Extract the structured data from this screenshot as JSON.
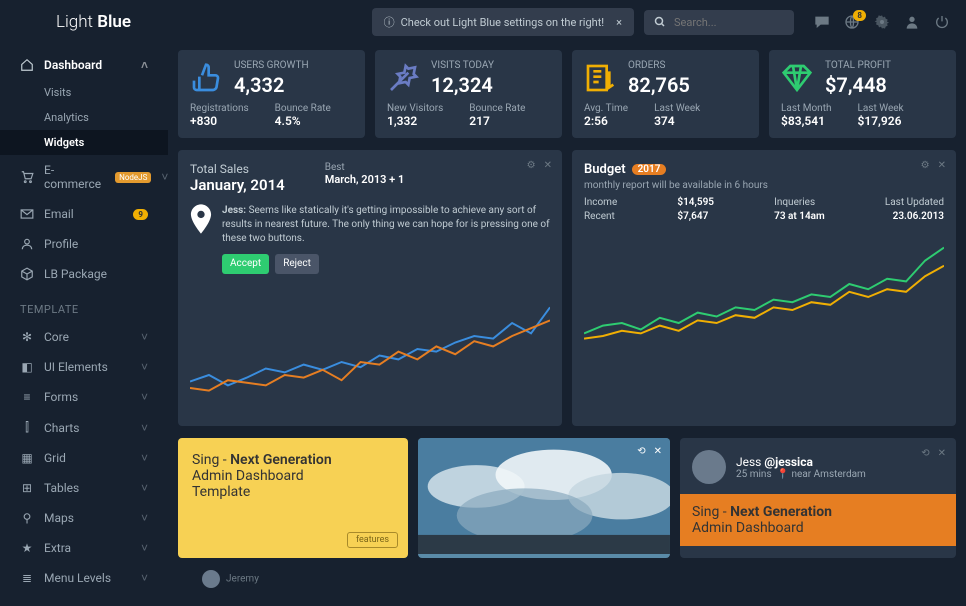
{
  "brand": {
    "a": "Light",
    "b": "Blue"
  },
  "alert": {
    "text": "Check out Light Blue settings on the right!",
    "close": "×"
  },
  "search": {
    "placeholder": "Search..."
  },
  "topbar": {
    "notif_badge": "8"
  },
  "sidebar": {
    "dashboard": "Dashboard",
    "subs": [
      "Visits",
      "Analytics",
      "Widgets"
    ],
    "items": [
      {
        "icon": "cart",
        "label": "E-commerce",
        "node": "NodeJS",
        "chev": true
      },
      {
        "icon": "mail",
        "label": "Email",
        "badge": "9"
      },
      {
        "icon": "user",
        "label": "Profile"
      },
      {
        "icon": "pkg",
        "label": "LB Package"
      }
    ],
    "tpl_header": "TEMPLATE",
    "tpl": [
      {
        "label": "Core"
      },
      {
        "label": "UI Elements"
      },
      {
        "label": "Forms"
      },
      {
        "label": "Charts"
      },
      {
        "label": "Grid"
      },
      {
        "label": "Tables"
      },
      {
        "label": "Maps"
      },
      {
        "label": "Extra"
      },
      {
        "label": "Menu Levels"
      }
    ]
  },
  "stats": [
    {
      "title": "USERS GROWTH",
      "value": "4,332",
      "a_lbl": "Registrations",
      "a_val": "+830",
      "b_lbl": "Bounce Rate",
      "b_val": "4.5%",
      "color": "#3a8dde"
    },
    {
      "title": "VISITS TODAY",
      "value": "12,324",
      "a_lbl": "New Visitors",
      "a_val": "1,332",
      "b_lbl": "Bounce Rate",
      "b_val": "217",
      "color": "#6a7cc4"
    },
    {
      "title": "ORDERS",
      "value": "82,765",
      "a_lbl": "Avg. Time",
      "a_val": "2:56",
      "b_lbl": "Last Week",
      "b_val": "374",
      "color": "#f0af03"
    },
    {
      "title": "TOTAL PROFIT",
      "value": "$7,448",
      "a_lbl": "Last Month",
      "a_val": "$83,541",
      "b_lbl": "Last Week",
      "b_val": "$17,926",
      "color": "#2ecc71"
    }
  ],
  "sales": {
    "title": "Total Sales",
    "date": "January, 2014",
    "best_lbl": "Best",
    "best_val": "March, 2013 + 1",
    "msg_author": "Jess:",
    "msg": "Seems like statically it's getting impossible to achieve any sort of results in nearest future. The only thing we can hope for is pressing one of these two buttons.",
    "accept": "Accept",
    "reject": "Reject"
  },
  "budget": {
    "title": "Budget",
    "year": "2017",
    "note": "monthly report will be available in 6 hours",
    "income_lbl": "Income",
    "income_val": "$14,595",
    "recent_lbl": "Recent",
    "recent_val": "$7,647",
    "inq_lbl": "Inqueries",
    "inq_val": "73 at 14am",
    "upd_lbl": "Last Updated",
    "upd_val": "23.06.2013"
  },
  "promo": {
    "line1a": "Sing - ",
    "line1b": "Next Generation",
    "line2": "Admin Dashboard",
    "line3": "Template",
    "features": "features"
  },
  "profile": {
    "name": "Jess ",
    "handle": "@jessica",
    "time": "25 mins",
    "loc": "near Amsterdam",
    "band1a": "Sing - ",
    "band1b": "Next Generation",
    "band2": "Admin Dashboard",
    "other": "Jeremy"
  },
  "chart_data": [
    {
      "type": "line",
      "title": "Total Sales",
      "x": [
        0,
        1,
        2,
        3,
        4,
        5,
        6,
        7,
        8,
        9,
        10,
        11,
        12,
        13,
        14,
        15,
        16,
        17,
        18,
        19
      ],
      "series": [
        {
          "name": "Blue",
          "color": "#3a8dde",
          "values": [
            25,
            30,
            22,
            28,
            35,
            32,
            38,
            34,
            40,
            36,
            45,
            42,
            50,
            48,
            55,
            60,
            58,
            70,
            62,
            82
          ]
        },
        {
          "name": "Orange",
          "color": "#e67e22",
          "values": [
            20,
            18,
            26,
            24,
            22,
            30,
            28,
            34,
            26,
            40,
            38,
            48,
            42,
            52,
            46,
            56,
            52,
            60,
            66,
            72
          ]
        }
      ],
      "ylim": [
        0,
        100
      ]
    },
    {
      "type": "line",
      "title": "Budget",
      "x": [
        0,
        1,
        2,
        3,
        4,
        5,
        6,
        7,
        8,
        9,
        10,
        11,
        12,
        13,
        14,
        15,
        16,
        17,
        18,
        19
      ],
      "series": [
        {
          "name": "Green",
          "color": "#2ecc71",
          "values": [
            22,
            28,
            30,
            25,
            34,
            30,
            38,
            35,
            42,
            40,
            48,
            46,
            52,
            50,
            60,
            56,
            64,
            62,
            78,
            88
          ]
        },
        {
          "name": "Yellow",
          "color": "#f0af03",
          "values": [
            18,
            20,
            24,
            22,
            28,
            24,
            32,
            30,
            36,
            34,
            42,
            40,
            46,
            44,
            54,
            50,
            56,
            54,
            66,
            74
          ]
        }
      ],
      "ylim": [
        0,
        100
      ]
    }
  ]
}
